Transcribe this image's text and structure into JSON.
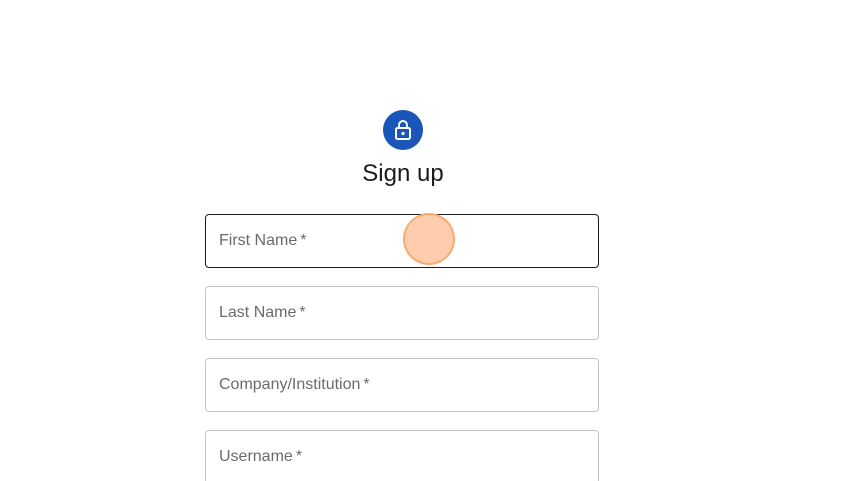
{
  "header": {
    "icon": "lock-icon",
    "icon_bg": "#1a56b8",
    "title": "Sign up"
  },
  "form": {
    "fields": [
      {
        "label": "First Name",
        "required_mark": "*",
        "focused": true
      },
      {
        "label": "Last Name",
        "required_mark": "*",
        "focused": false
      },
      {
        "label": "Company/Institution",
        "required_mark": "*",
        "focused": false
      },
      {
        "label": "Username",
        "required_mark": "*",
        "focused": false
      }
    ]
  },
  "colors": {
    "field_border": "#c4c4c4",
    "field_border_focused": "#1c1c1c",
    "label_text": "#6b6b6b",
    "cursor_fill": "#ffc4a0"
  }
}
